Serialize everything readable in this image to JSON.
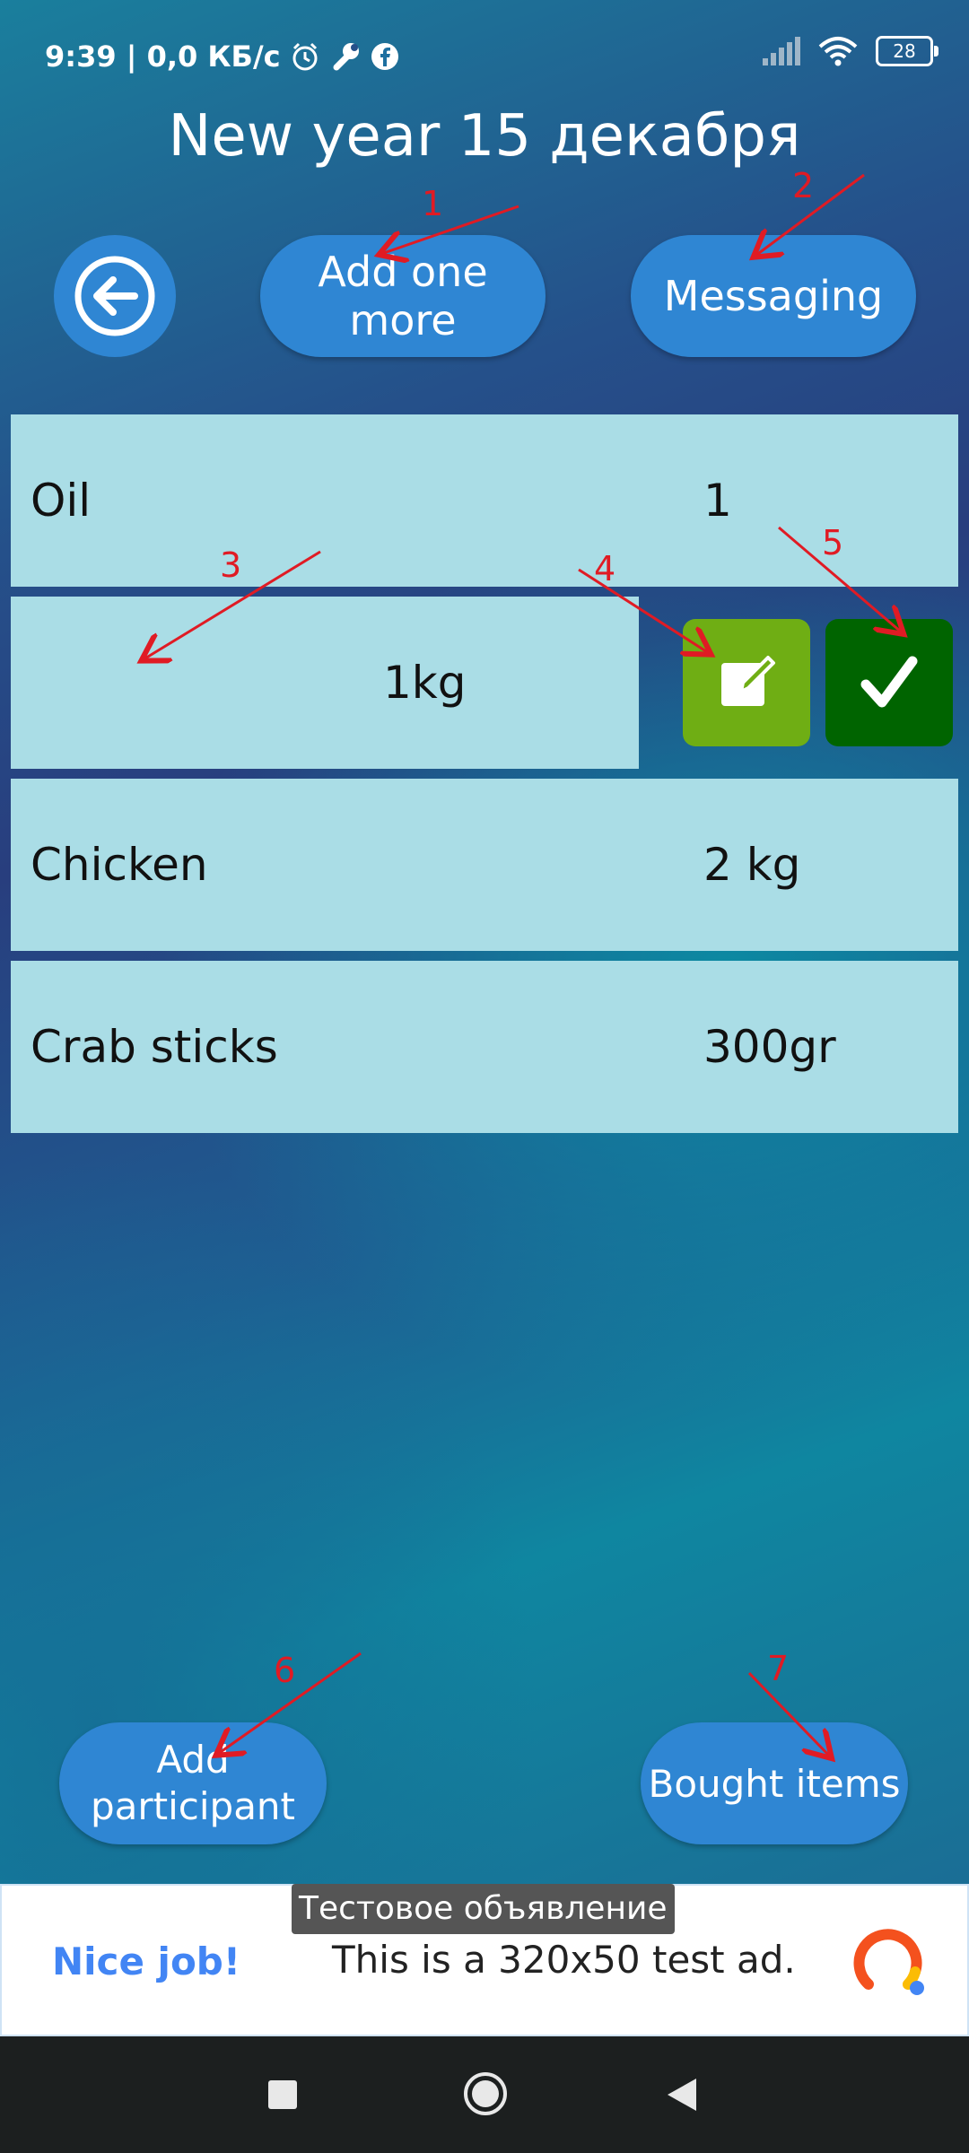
{
  "status_bar": {
    "time_speed": "9:39 | 0,0 КБ/с",
    "battery": "28",
    "icons": [
      "alarm-icon",
      "wrench-icon",
      "facebook-icon",
      "signal-icon",
      "wifi-icon",
      "battery-icon"
    ]
  },
  "header": {
    "title": "New year 15 декабря"
  },
  "toolbar": {
    "back_icon": "back-arrow-icon",
    "add_label": "Add one more",
    "messaging_label": "Messaging"
  },
  "items": [
    {
      "name": "Oil",
      "qty": "1"
    },
    {
      "name": "",
      "qty": "1kg"
    },
    {
      "name": "Chicken",
      "qty": "2 kg"
    },
    {
      "name": "Crab sticks",
      "qty": "300gr"
    }
  ],
  "item_actions": {
    "edit_icon": "edit-icon",
    "confirm_icon": "checkmark-icon",
    "edit_color": "#6fae14",
    "confirm_color": "#006400"
  },
  "annotations": [
    "1",
    "2",
    "3",
    "4",
    "5",
    "6",
    "7"
  ],
  "bottom": {
    "add_participant_label": "Add participant",
    "bought_label": "Bought items"
  },
  "ad": {
    "tag": "Тестовое объявление",
    "nice": "Nice job!",
    "text": "This is a 320x50 test ad.",
    "logo": "ad-logo-icon"
  },
  "nav": {
    "icons": [
      "recents-icon",
      "home-icon",
      "back-icon"
    ]
  },
  "colors": {
    "accent": "#2f86d3",
    "row_bg": "#aadde6",
    "annotation": "#e01b24"
  }
}
